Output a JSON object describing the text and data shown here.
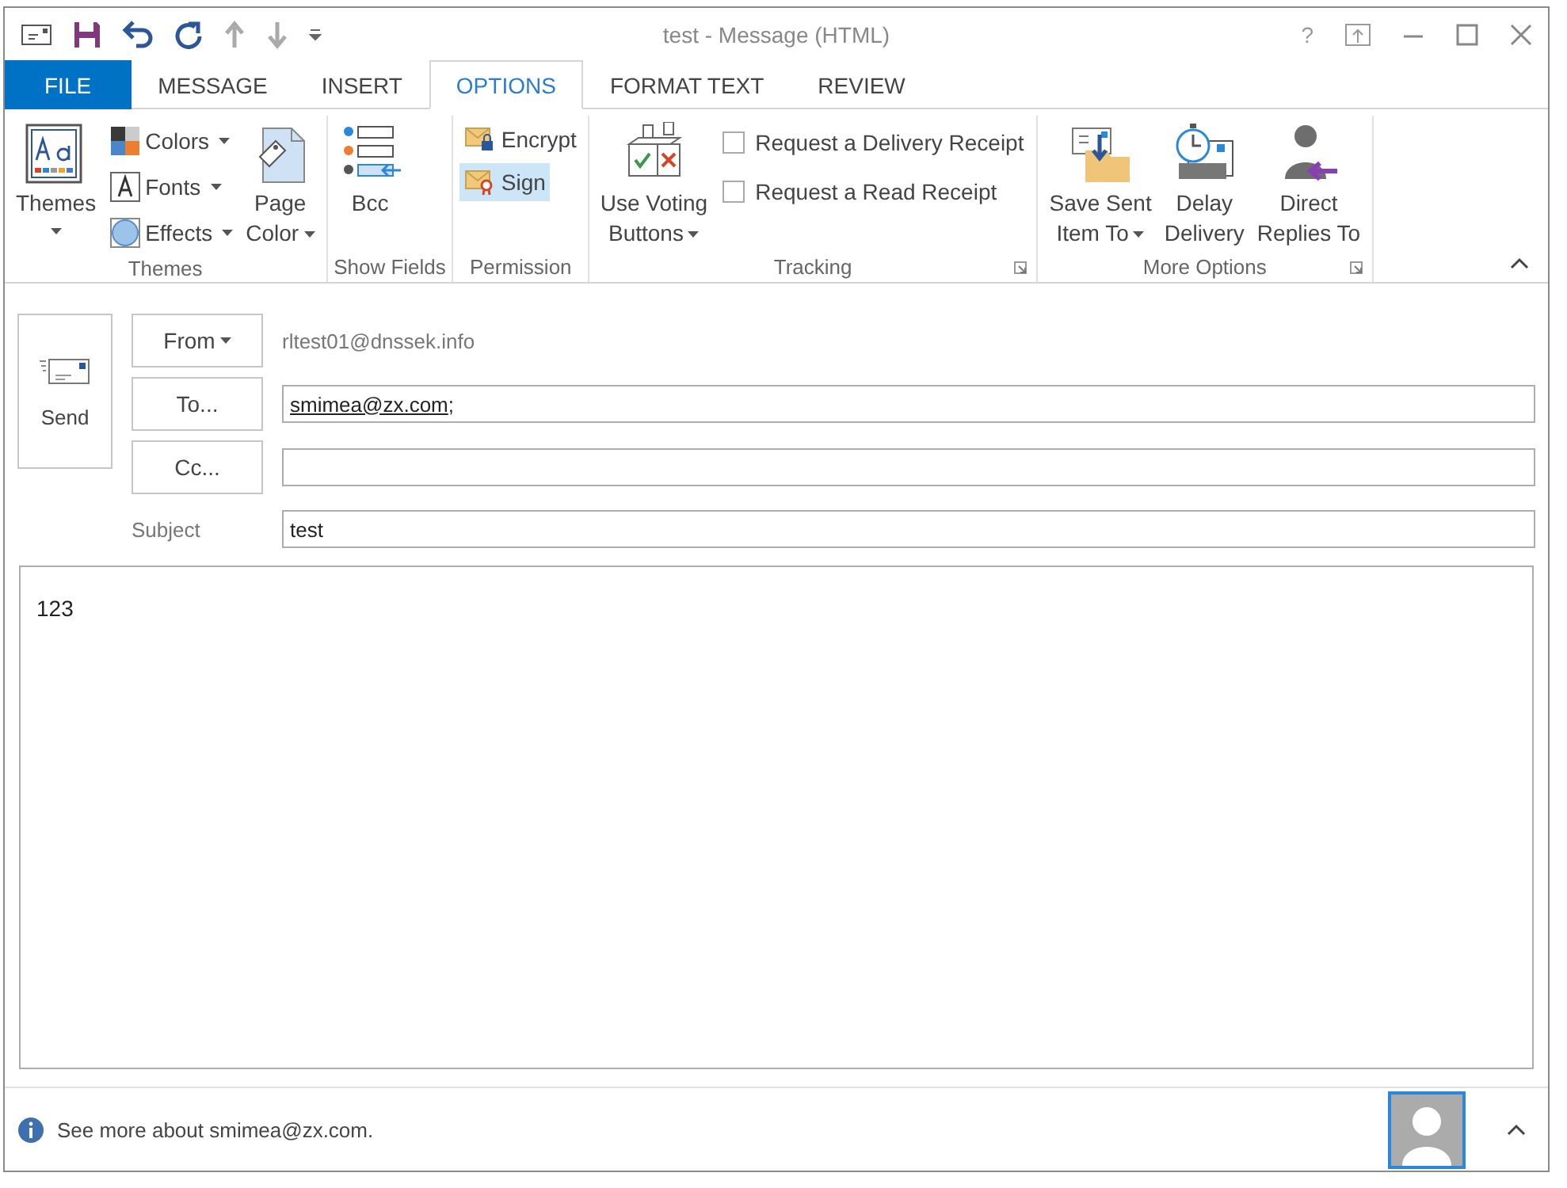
{
  "window": {
    "title": "test - Message (HTML)",
    "help": "?"
  },
  "tabs": [
    {
      "label": "FILE",
      "kind": "file",
      "selected": false
    },
    {
      "label": "MESSAGE",
      "kind": "tab",
      "selected": false
    },
    {
      "label": "INSERT",
      "kind": "tab",
      "selected": false
    },
    {
      "label": "OPTIONS",
      "kind": "tab",
      "selected": true
    },
    {
      "label": "FORMAT TEXT",
      "kind": "tab",
      "selected": false
    },
    {
      "label": "REVIEW",
      "kind": "tab",
      "selected": false
    }
  ],
  "ribbon": {
    "groups": [
      {
        "label": "Themes",
        "launcher": false,
        "columns": [
          [
            {
              "kind": "large",
              "lines": [
                "Themes"
              ],
              "dropdown": true
            }
          ],
          [
            {
              "kind": "small",
              "label": "Colors",
              "dropdown": true,
              "on": false
            },
            {
              "kind": "small",
              "label": "Fonts",
              "dropdown": true,
              "on": false
            },
            {
              "kind": "small",
              "label": "Effects",
              "dropdown": true,
              "on": false
            }
          ],
          [
            {
              "kind": "large",
              "lines": [
                "Page",
                "Color"
              ],
              "dropdown": true
            }
          ]
        ]
      },
      {
        "label": "Show Fields",
        "launcher": false,
        "columns": [
          [
            {
              "kind": "large",
              "lines": [
                "Bcc"
              ],
              "dropdown": false
            }
          ]
        ]
      },
      {
        "label": "Permission",
        "launcher": false,
        "columns": [
          [
            {
              "kind": "small",
              "label": "Encrypt",
              "dropdown": false,
              "on": false
            },
            {
              "kind": "small",
              "label": "Sign",
              "dropdown": false,
              "on": true
            }
          ]
        ]
      },
      {
        "label": "Tracking",
        "launcher": true,
        "columns": [
          [
            {
              "kind": "large",
              "lines": [
                "Use Voting",
                "Buttons"
              ],
              "dropdown": true
            }
          ],
          [
            {
              "kind": "check",
              "label": "Request a Delivery Receipt",
              "checked": false
            },
            {
              "kind": "check",
              "label": "Request a Read Receipt",
              "checked": false
            }
          ]
        ]
      },
      {
        "label": "More Options",
        "launcher": true,
        "columns": [
          [
            {
              "kind": "large",
              "lines": [
                "Save Sent",
                "Item To"
              ],
              "dropdown": true
            }
          ],
          [
            {
              "kind": "large",
              "lines": [
                "Delay",
                "Delivery"
              ],
              "dropdown": false
            }
          ],
          [
            {
              "kind": "large",
              "lines": [
                "Direct",
                "Replies To"
              ],
              "dropdown": false
            }
          ]
        ]
      }
    ]
  },
  "send": {
    "label": "Send"
  },
  "fields": [
    {
      "kind": "from",
      "button": "From",
      "dropdown": true,
      "value": "rltest01@dnssek.info"
    },
    {
      "kind": "recipient",
      "button": "To...",
      "recipients": [
        {
          "address": "smimea@zx.com",
          "separator": ";"
        }
      ]
    },
    {
      "kind": "recipient",
      "button": "Cc..."
    },
    {
      "kind": "subject",
      "label": "Subject",
      "value": "test"
    }
  ],
  "body": {
    "text": "123"
  },
  "people_pane": {
    "text": "See more about smimea@zx.com."
  }
}
